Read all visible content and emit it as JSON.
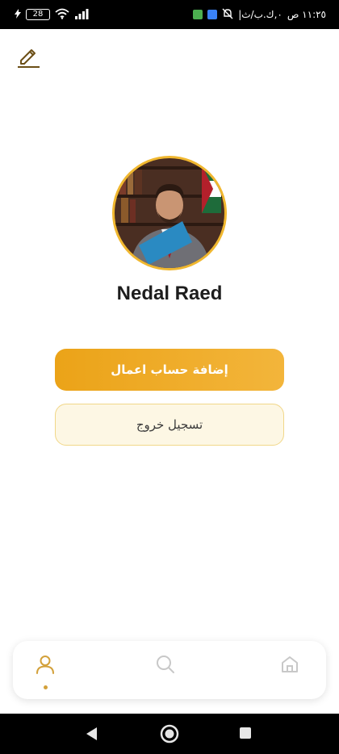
{
  "status_bar": {
    "time": "١١:٢٥ ص",
    "carrier_text": "|٠,ك.ب/ث",
    "battery": "28",
    "colors": {
      "green_badge": "#4caf50",
      "blue_badge": "#3a82f7"
    },
    "icons": [
      "charging-icon",
      "battery-icon",
      "wifi-icon",
      "signal-icon",
      "mute-bell-icon"
    ]
  },
  "header": {
    "edit_icon": "edit-pencil-icon"
  },
  "profile": {
    "name": "Nedal Raed",
    "avatar_ring_color": "#f0b72f"
  },
  "actions": {
    "add_business": "إضافة حساب اعمال",
    "logout": "تسجيل خروج"
  },
  "bottom_nav": {
    "items": [
      {
        "icon": "profile-icon",
        "active": true
      },
      {
        "icon": "search-icon",
        "active": false
      },
      {
        "icon": "home-icon",
        "active": false
      }
    ],
    "active_color": "#d3a13b",
    "inactive_color": "#c8c8c8"
  },
  "system_nav": {
    "icons": [
      "back-icon",
      "home-circle-icon",
      "recents-icon"
    ]
  }
}
